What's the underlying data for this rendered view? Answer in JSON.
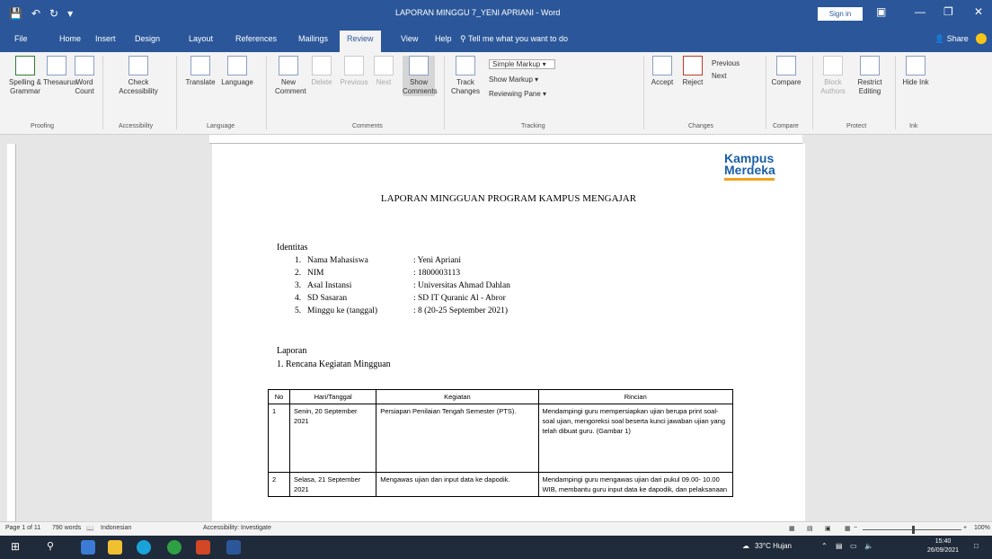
{
  "titlebar": {
    "doc_title": "LAPORAN MINGGU 7_YENI APRIANI - Word",
    "sign_in": "Sign in"
  },
  "menu": {
    "tabs": [
      "File",
      "Home",
      "Insert",
      "Design",
      "Layout",
      "References",
      "Mailings",
      "Review",
      "View",
      "Help"
    ],
    "active_tab": "Review",
    "tell_me": "Tell me what you want to do",
    "share": "Share"
  },
  "ribbon": {
    "spelling": "Spelling & Grammar",
    "thesaurus": "Thesaurus",
    "word_count": "Word Count",
    "proofing": "Proofing",
    "check_accessibility": "Check Accessibility",
    "accessibility": "Accessibility",
    "translate": "Translate",
    "language": "Language",
    "language_group": "Language",
    "new_comment": "New Comment",
    "delete": "Delete",
    "previous": "Previous",
    "next": "Next",
    "show_comments": "Show Comments",
    "comments": "Comments",
    "track_changes": "Track Changes",
    "simple_markup": "Simple Markup",
    "show_markup": "Show Markup",
    "reviewing_pane": "Reviewing Pane",
    "tracking": "Tracking",
    "accept": "Accept",
    "reject": "Reject",
    "prev_change": "Previous",
    "next_change": "Next",
    "changes": "Changes",
    "compare": "Compare",
    "compare_group": "Compare",
    "block_authors": "Block Authors",
    "restrict_editing": "Restrict Editing",
    "protect": "Protect",
    "hide_ink": "Hide Ink",
    "ink": "Ink"
  },
  "document": {
    "logo_line1": "Kampus",
    "logo_line2": "Merdeka",
    "heading": "LAPORAN MINGGUAN PROGRAM KAMPUS MENGAJAR",
    "identitas": "Identitas",
    "identity": [
      {
        "num": "1.",
        "label": "Nama Mahasiswa",
        "value": ": Yeni Apriani"
      },
      {
        "num": "2.",
        "label": "NIM",
        "value": ": 1800003113"
      },
      {
        "num": "3.",
        "label": "Asal Instansi",
        "value": ": Universitas Ahmad Dahlan"
      },
      {
        "num": "4.",
        "label": "SD Sasaran",
        "value": ": SD IT Quranic Al - Abror"
      },
      {
        "num": "5.",
        "label": "Minggu ke (tanggal)",
        "value": ": 8 (20-25 September 2021)"
      }
    ],
    "laporan": "Laporan",
    "section1": "1.  Rencana Kegiatan Mingguan",
    "table": {
      "headers": [
        "No",
        "Hari/Tanggal",
        "Kegiatan",
        "Rincian"
      ],
      "rows": [
        [
          "1",
          "Senin, 20 September 2021",
          "Persiapan Penilaian Tengah Semester (PTS).",
          "Mendampingi guru mempersiapkan ujian berupa print soal-soal ujian, mengoreksi soal beserta kunci jawaban ujian yang telah dibuat guru. (Gambar 1)"
        ],
        [
          "2",
          "Selasa, 21 September 2021",
          "Mengawas ujian dan input data ke dapodik.",
          "Mendampingi guru mengawas ujian dari pukul 09.00- 10.00 WIB, membantu guru input data ke dapodik, dan pelaksanaan"
        ]
      ]
    }
  },
  "status": {
    "page": "Page 1 of 11",
    "words": "790 words",
    "language": "Indonesian",
    "accessibility": "Accessibility: Investigate",
    "zoom": "100%"
  },
  "taskbar": {
    "weather": "33°C  Hujan",
    "time": "15:40",
    "date": "26/09/2021"
  }
}
